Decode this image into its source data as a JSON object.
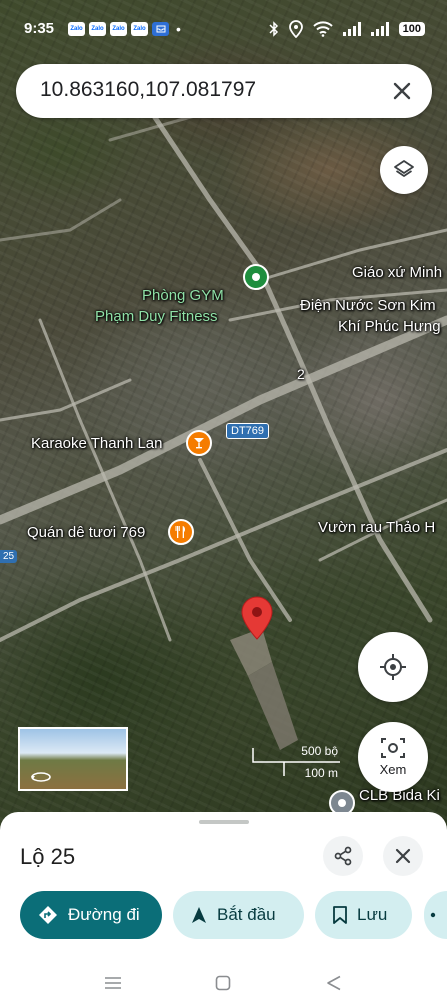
{
  "status_bar": {
    "time": "9:35",
    "app_icons": [
      "Zalo",
      "Zalo",
      "Zalo",
      "Zalo"
    ],
    "dot": "•",
    "battery": "100"
  },
  "search": {
    "query": "10.863160,107.081797",
    "close_icon": "close-icon"
  },
  "map": {
    "labels": {
      "giao_xu": "Giáo xứ Minh",
      "gym_line1": "Phòng GYM",
      "gym_line2": "Phạm Duy Fitness",
      "dien_nuoc": "Điện Nước Sơn Kim",
      "khi_phuc_hung": "Khí Phúc Hưng",
      "karaoke": "Karaoke Thanh Lan",
      "quan_de": "Quán dê tươi 769",
      "vuon_rau": "Vườn rau Thảo H",
      "clb_bida": "CLB Bida Ki",
      "road_number": "2"
    },
    "road_shield": "DT769",
    "edge_shield": "25",
    "scale": {
      "imperial": "500 bộ",
      "metric": "100 m"
    },
    "colors": {
      "pin_red": "#e53935",
      "gym_green": "#1e8e3e",
      "food_orange": "#f57c00"
    }
  },
  "buttons": {
    "layers_icon": "layers-icon",
    "location_icon": "my-location-icon",
    "xem_label": "Xem"
  },
  "sheet": {
    "title": "Lộ 25",
    "chips": {
      "directions": "Đường đi",
      "start": "Bắt đầu",
      "save": "Lưu"
    },
    "colors": {
      "primary": "#0b6e78",
      "secondary": "#d3eef0"
    }
  }
}
